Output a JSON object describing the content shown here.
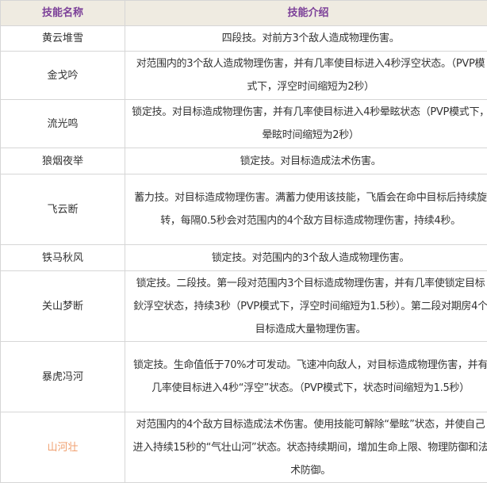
{
  "header": {
    "name": "技能名称",
    "desc": "技能介绍"
  },
  "highlight_color": "#f0a070",
  "rows": [
    {
      "name": "黄云堆雪",
      "desc": "四段技。对前方3个敌人造成物理伤害。"
    },
    {
      "name": "金戈吟",
      "desc": "对范围内的3个敌人造成物理伤害，并有几率使目标进入4秒浮空状态。（PVP模式下，浮空时间缩短为2秒）"
    },
    {
      "name": "流光鸣",
      "desc": "锁定技。对目标造成物理伤害，并有几率使目标进入4秒晕眩状态（PVP模式下，晕眩时间缩短为2秒）"
    },
    {
      "name": "狼烟夜举",
      "desc": "锁定技。对目标造成法术伤害。"
    },
    {
      "name": "飞云断",
      "desc": "蓄力技。对目标造成物理伤害。满蓄力使用该技能，飞盾会在命中目标后持续旋转，每隔0.5秒会对范围内的4个敌方目标造成物理伤害，持续4秒。"
    },
    {
      "name": "铁马秋风",
      "desc": "锁定技。对范围内的3个敌人造成物理伤害。"
    },
    {
      "name": "关山梦断",
      "desc": "锁定技。二段技。第一段对范围内3个目标造成物理伤害，并有几率使锁定目标鈥浮空状态，持续3秒（PVP模式下，浮空时间缩短为1.5秒）。第二段对期房4个目标造成大量物理伤害。"
    },
    {
      "name": "暴虎冯河",
      "desc": "锁定技。生命值低于70%才可发动。飞速冲向敌人，对目标造成物理伤害，并有几率使目标进入4秒“浮空”状态。（PVP模式下，状态时间缩短为1.5秒）"
    },
    {
      "name": "山河壮",
      "desc": "对范围内的4个敌方目标造成法术伤害。使用技能可解除“晕眩”状态，并使自己进入持续15秒的“气壮山河”状态。状态持续期间，增加生命上限、物理防御和法术防御。"
    }
  ]
}
